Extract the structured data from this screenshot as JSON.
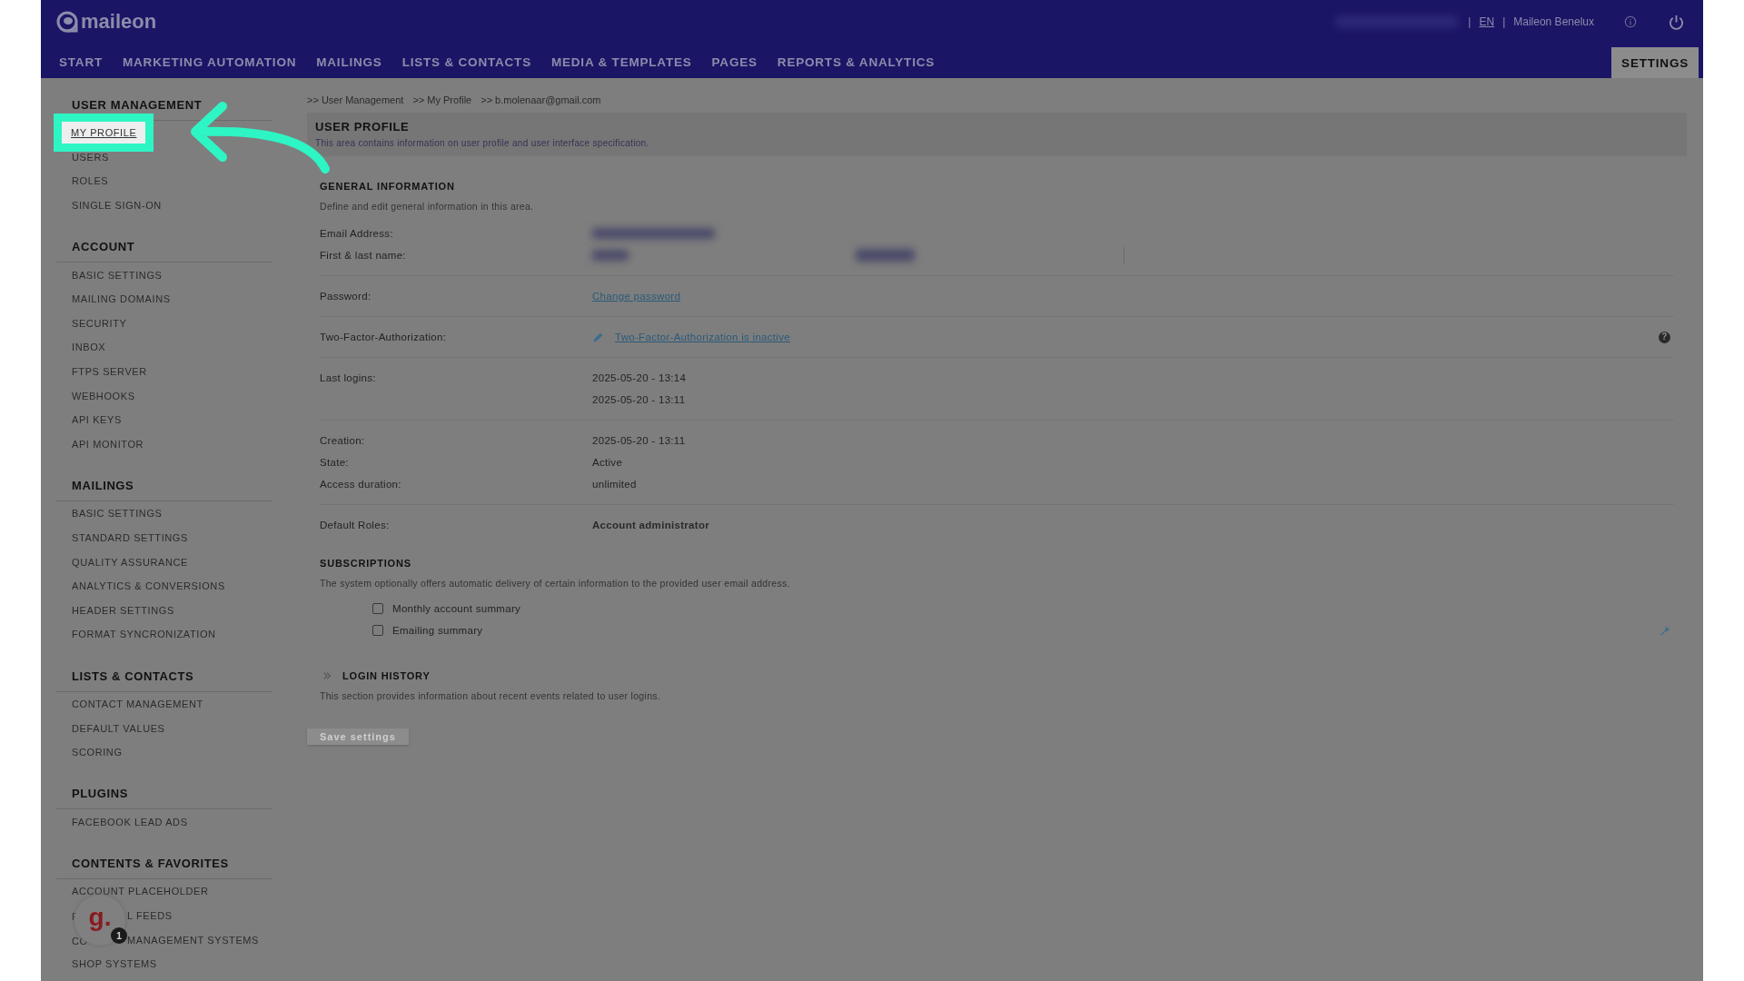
{
  "header": {
    "logo": "maileon",
    "separators": [
      "|",
      "|"
    ],
    "language": "EN",
    "account": "Maileon Benelux"
  },
  "nav": [
    {
      "label": "START",
      "selected": false
    },
    {
      "label": "MARKETING AUTOMATION",
      "selected": false
    },
    {
      "label": "MAILINGS",
      "selected": false
    },
    {
      "label": "LISTS & CONTACTS",
      "selected": false
    },
    {
      "label": "MEDIA & TEMPLATES",
      "selected": false
    },
    {
      "label": "PAGES",
      "selected": false
    },
    {
      "label": "REPORTS & ANALYTICS",
      "selected": false
    },
    {
      "label": "SETTINGS",
      "selected": true
    }
  ],
  "sidebar": [
    {
      "heading": "USER MANAGEMENT",
      "items": [
        {
          "label": "MY PROFILE",
          "selected": true
        },
        {
          "label": "USERS",
          "selected": false
        },
        {
          "label": "ROLES",
          "selected": false
        },
        {
          "label": "SINGLE SIGN-ON",
          "selected": false
        }
      ]
    },
    {
      "heading": "ACCOUNT",
      "items": [
        {
          "label": "BASIC SETTINGS",
          "selected": false
        },
        {
          "label": "MAILING DOMAINS",
          "selected": false
        },
        {
          "label": "SECURITY",
          "selected": false
        },
        {
          "label": "INBOX",
          "selected": false
        },
        {
          "label": "FTPS SERVER",
          "selected": false
        },
        {
          "label": "WEBHOOKS",
          "selected": false
        },
        {
          "label": "API KEYS",
          "selected": false
        },
        {
          "label": "API MONITOR",
          "selected": false
        }
      ]
    },
    {
      "heading": "MAILINGS",
      "items": [
        {
          "label": "BASIC SETTINGS",
          "selected": false
        },
        {
          "label": "STANDARD SETTINGS",
          "selected": false
        },
        {
          "label": "QUALITY ASSURANCE",
          "selected": false
        },
        {
          "label": "ANALYTICS & CONVERSIONS",
          "selected": false
        },
        {
          "label": "HEADER SETTINGS",
          "selected": false
        },
        {
          "label": "FORMAT SYNCRONIZATION",
          "selected": false
        }
      ]
    },
    {
      "heading": "LISTS & CONTACTS",
      "items": [
        {
          "label": "CONTACT MANAGEMENT",
          "selected": false
        },
        {
          "label": "DEFAULT VALUES",
          "selected": false
        },
        {
          "label": "SCORING",
          "selected": false
        }
      ]
    },
    {
      "heading": "PLUGINS",
      "items": [
        {
          "label": "FACEBOOK LEAD ADS",
          "selected": false
        }
      ]
    },
    {
      "heading": "CONTENTS & FAVORITES",
      "items": [
        {
          "label": "ACCOUNT PLACEHOLDER",
          "selected": false
        },
        {
          "parts": [
            "F",
            "L FEEDS"
          ],
          "selected": false
        },
        {
          "parts": [
            "CO",
            "MANAGEMENT SYSTEMS"
          ],
          "selected": false
        },
        {
          "label": "SHOP SYSTEMS",
          "selected": false
        }
      ]
    }
  ],
  "breadcrumb": [
    ">> User Management",
    ">> My Profile",
    ">> b.molenaar@gmail.com"
  ],
  "panel": {
    "title": "USER PROFILE",
    "description": "This area contains information on user profile and user interface specification."
  },
  "general": {
    "title": "GENERAL INFORMATION",
    "description": "Define and edit general information in this area.",
    "groups": [
      [
        {
          "label": "Email Address:",
          "kind": "blurred"
        },
        {
          "label": "First & last name:",
          "kind": "blurred_pair"
        }
      ],
      [
        {
          "label": "Password:",
          "kind": "link",
          "value": "Change password"
        }
      ],
      [
        {
          "label": "Two-Factor-Authorization:",
          "kind": "edit_link",
          "value": "Two-Factor-Authorization is inactive",
          "help": "?"
        }
      ],
      [
        {
          "label": "Last logins:",
          "kind": "lines",
          "values": [
            "2025-05-20 - 13:14",
            "2025-05-20 - 13:11"
          ]
        }
      ],
      [
        {
          "label": "Creation:",
          "kind": "text",
          "value": "2025-05-20 - 13:11"
        },
        {
          "label": "State:",
          "kind": "text",
          "value": "Active"
        },
        {
          "label": "Access duration:",
          "kind": "text",
          "value": "unlimited"
        }
      ],
      [
        {
          "label": "Default Roles:",
          "kind": "strong",
          "value": "Account administrator"
        }
      ]
    ]
  },
  "subscriptions": {
    "title": "SUBSCRIPTIONS",
    "description": "The system optionally offers automatic delivery of certain information to the provided user email address.",
    "options": [
      {
        "label": "Monthly account summary",
        "checked": false
      },
      {
        "label": "Emailing summary",
        "checked": false
      }
    ]
  },
  "login_history": {
    "title": "LOGIN HISTORY",
    "expanded": false,
    "description": "This section provides information about recent events related to user logins."
  },
  "save_button": {
    "label": "Save settings",
    "disabled": true
  },
  "widget": {
    "logo": "g.",
    "badge": "1"
  }
}
